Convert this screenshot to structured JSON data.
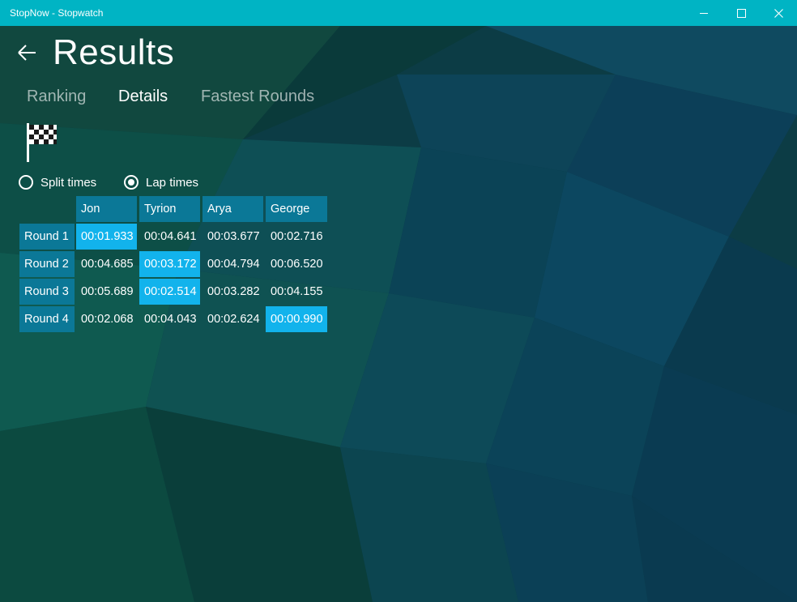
{
  "window": {
    "title": "StopNow - Stopwatch"
  },
  "page": {
    "title": "Results"
  },
  "tabs": [
    {
      "label": "Ranking",
      "active": false
    },
    {
      "label": "Details",
      "active": true
    },
    {
      "label": "Fastest Rounds",
      "active": false
    }
  ],
  "icons": {
    "back": "back-arrow-icon",
    "flag": "checkered-flag-icon"
  },
  "mode": {
    "options": [
      {
        "label": "Split times",
        "checked": false
      },
      {
        "label": "Lap times",
        "checked": true
      }
    ]
  },
  "table": {
    "columns": [
      "Jon",
      "Tyrion",
      "Arya",
      "George"
    ],
    "rows": [
      {
        "label": "Round 1",
        "times": [
          "00:01.933",
          "00:04.641",
          "00:03.677",
          "00:02.716"
        ],
        "fastest_index": 0
      },
      {
        "label": "Round 2",
        "times": [
          "00:04.685",
          "00:03.172",
          "00:04.794",
          "00:06.520"
        ],
        "fastest_index": 1
      },
      {
        "label": "Round 3",
        "times": [
          "00:05.689",
          "00:02.514",
          "00:03.282",
          "00:04.155"
        ],
        "fastest_index": 1
      },
      {
        "label": "Round 4",
        "times": [
          "00:02.068",
          "00:04.043",
          "00:02.624",
          "00:00.990"
        ],
        "fastest_index": 3
      }
    ]
  },
  "colors": {
    "titlebar": "#00b4c4",
    "header_cell": "#0b7897",
    "fastest_cell": "#12b3ec"
  }
}
